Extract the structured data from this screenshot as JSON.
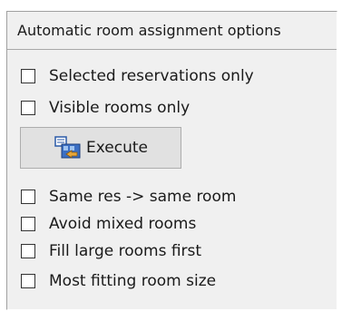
{
  "panel": {
    "title": "Automatic room assignment options",
    "options_top": [
      {
        "label": "Selected reservations only",
        "checked": false
      },
      {
        "label": "Visible rooms only",
        "checked": false
      }
    ],
    "execute_label": "Execute",
    "execute_icon": "room-assign-icon",
    "options_bottom": [
      {
        "label": "Same res -> same room",
        "checked": false
      },
      {
        "label": "Avoid mixed rooms",
        "checked": false
      },
      {
        "label": "Fill large rooms first",
        "checked": false
      },
      {
        "label": "Most fitting room size",
        "checked": false
      }
    ]
  }
}
